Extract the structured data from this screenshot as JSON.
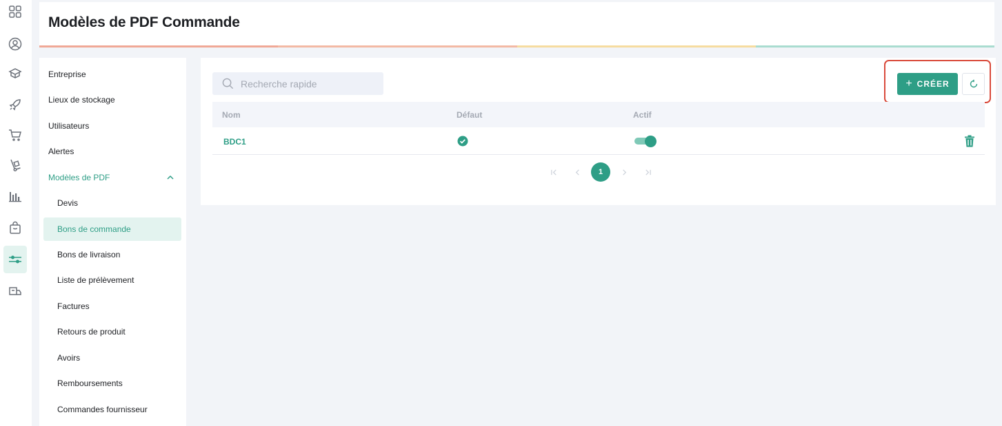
{
  "header": {
    "title": "Modèles de PDF Commande",
    "stripe_colors": [
      "#f0a896",
      "#f3b9a4",
      "#f6dca0",
      "#a9dcd0"
    ]
  },
  "rail": {
    "icons": [
      "dashboard-icon",
      "user-circle-icon",
      "box-icon",
      "rocket-icon",
      "cart-icon",
      "dolly-icon",
      "bar-chart-icon",
      "shopping-bag-icon",
      "sliders-icon",
      "truck-icon"
    ],
    "active": "sliders-icon"
  },
  "menu": {
    "items": [
      {
        "label": "Entreprise"
      },
      {
        "label": "Lieux de stockage"
      },
      {
        "label": "Utilisateurs"
      },
      {
        "label": "Alertes"
      },
      {
        "label": "Modèles de PDF"
      }
    ],
    "sub_items": [
      {
        "label": "Devis"
      },
      {
        "label": "Bons de commande"
      },
      {
        "label": "Bons de livraison"
      },
      {
        "label": "Liste de prélèvement"
      },
      {
        "label": "Factures"
      },
      {
        "label": "Retours de produit"
      },
      {
        "label": "Avoirs"
      },
      {
        "label": "Remboursements"
      },
      {
        "label": "Commandes fournisseur"
      }
    ],
    "selected": "Bons de commande"
  },
  "search": {
    "placeholder": "Recherche rapide",
    "value": ""
  },
  "toolbar": {
    "create_label": "CRÉER",
    "create_icon": "plus-icon",
    "refresh_icon": "refresh-icon"
  },
  "table": {
    "columns": [
      "Nom",
      "Défaut",
      "Actif"
    ],
    "rows": [
      {
        "name": "BDC1",
        "default": true,
        "active": true
      }
    ]
  },
  "pagination": {
    "current": "1"
  },
  "colors": {
    "accent": "#2e9e86",
    "highlight_border": "#d9493a",
    "background": "#f2f4f8"
  }
}
